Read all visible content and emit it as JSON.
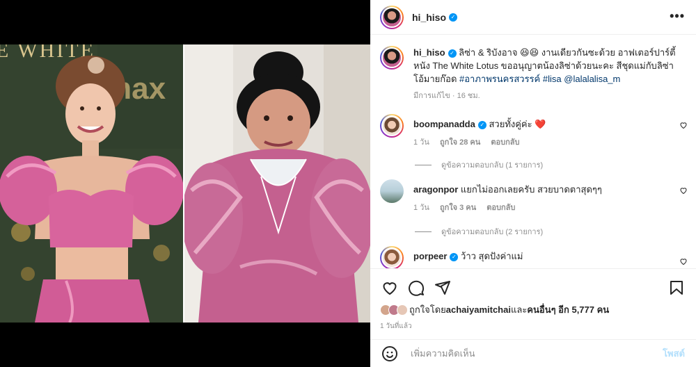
{
  "header": {
    "username": "hi_hiso",
    "more_icon": "more-horizontal-icon"
  },
  "media": {
    "sign_text": "E WHITE",
    "brand_text": "max"
  },
  "caption": {
    "username": "hi_hiso",
    "text_line1": "ลิซ่า & ริบังอาจ 😆😆 งานเดียวกันซะด้วย อาฟเตอร์ปาร์ตี้หนัง The White Lotus ขออนุญาตน้องลิซ่าด้วยนะคะ สีชุดแม่กับลิซ่าโอ้มายก๊อด ",
    "hashtag": "#อาภาพรนครสวรรค์",
    "hashtag2": "#lisa",
    "mention": "@lalalalisa_m",
    "meta": "มีการแก้ไข · 16 ชม."
  },
  "comments": [
    {
      "username": "boompanadda",
      "verified": true,
      "text": "สวยทั้งคู่ค่ะ",
      "emoji": "❤️",
      "time": "1 วัน",
      "likes": "ถูกใจ 28 คน",
      "reply": "ตอบกลับ",
      "view_replies": "ดูข้อความตอบกลับ (1 รายการ)"
    },
    {
      "username": "aragonpor",
      "verified": false,
      "text": "แยกไม่ออกเลยครับ สวยบาดตาสุดๆๆ",
      "time": "1 วัน",
      "likes": "ถูกใจ 3 คน",
      "reply": "ตอบกลับ",
      "view_replies": "ดูข้อความตอบกลับ (2 รายการ)"
    },
    {
      "username": "porpeer",
      "verified": true,
      "text": "ว้าว สุดปังค่าแม่"
    }
  ],
  "actions": {
    "like_icon": "heart-icon",
    "comment_icon": "comment-icon",
    "share_icon": "send-icon",
    "save_icon": "bookmark-icon"
  },
  "likes": {
    "prefix": "ถูกใจโดย ",
    "user": "achaiyamitchai",
    "middle": " และ",
    "others": "คนอื่นๆ อีก 5,777 คน"
  },
  "timestamp": "1 วันที่แล้ว",
  "add_comment": {
    "placeholder": "เพิ่มความคิดเห็น",
    "post_label": "โพสต์"
  },
  "colors": {
    "verified": "#0095f6",
    "link": "#00376b",
    "post_disabled": "#b2dffc",
    "dress": "#d76fa0"
  }
}
